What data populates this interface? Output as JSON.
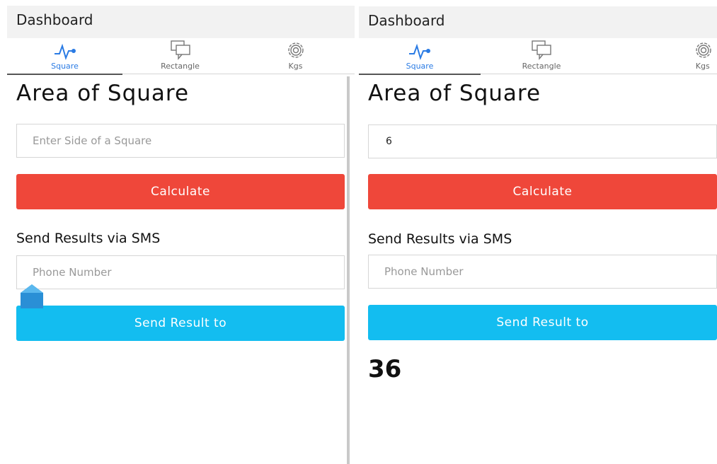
{
  "left": {
    "app_title": "Dashboard",
    "tabs": [
      {
        "label": "Square",
        "icon": "pulse-icon",
        "active": true
      },
      {
        "label": "Rectangle",
        "icon": "chat-bubbles-icon",
        "active": false
      },
      {
        "label": "Kgs",
        "icon": "gear-icon",
        "active": false
      }
    ],
    "heading": "Area of Square",
    "side_input_placeholder": "Enter Side of a Square",
    "calculate_label": "Calculate",
    "sms_heading": "Send Results via SMS",
    "phone_placeholder": "Phone Number",
    "send_label": "Send Result to"
  },
  "right": {
    "app_title": "Dashboard",
    "tabs": [
      {
        "label": "Square",
        "icon": "pulse-icon",
        "active": true
      },
      {
        "label": "Rectangle",
        "icon": "chat-bubbles-icon",
        "active": false
      },
      {
        "label": "Kgs",
        "icon": "gear-icon",
        "active": false
      }
    ],
    "heading": "Area of Square",
    "side_input_value": "6",
    "calculate_label": "Calculate",
    "sms_heading": "Send Results via SMS",
    "phone_placeholder": "Phone Number",
    "send_label": "Send Result to",
    "result": "36"
  },
  "colors": {
    "accent_blue": "#2a7be4",
    "calculate_red": "#ef473a",
    "send_cyan": "#13bdf0"
  }
}
